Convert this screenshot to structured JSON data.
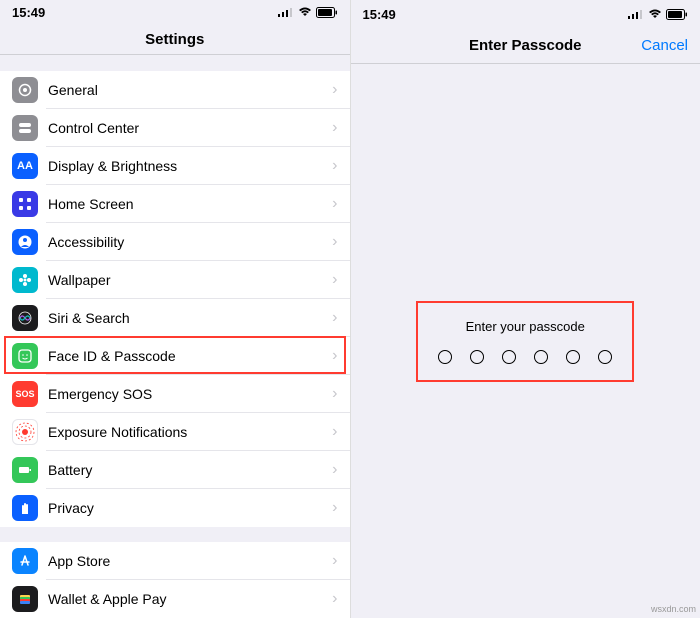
{
  "status": {
    "time": "15:49",
    "location_arrow": "↗"
  },
  "left": {
    "title": "Settings",
    "items": [
      {
        "label": "General",
        "icon": "gear",
        "color": "#8e8e93"
      },
      {
        "label": "Control Center",
        "icon": "switches",
        "color": "#8e8e93"
      },
      {
        "label": "Display & Brightness",
        "icon": "AA",
        "color": "#0a60ff"
      },
      {
        "label": "Home Screen",
        "icon": "grid",
        "color": "#3a3ae6"
      },
      {
        "label": "Accessibility",
        "icon": "person",
        "color": "#0a60ff"
      },
      {
        "label": "Wallpaper",
        "icon": "flower",
        "color": "#00b9ce"
      },
      {
        "label": "Siri & Search",
        "icon": "siri",
        "color": "#1c1c1e"
      },
      {
        "label": "Face ID & Passcode",
        "icon": "face",
        "color": "#34c759"
      },
      {
        "label": "Emergency SOS",
        "icon": "SOS",
        "color": "#ff3b30"
      },
      {
        "label": "Exposure Notifications",
        "icon": "exposure",
        "color": "#ffffff"
      },
      {
        "label": "Battery",
        "icon": "battery",
        "color": "#34c759"
      },
      {
        "label": "Privacy",
        "icon": "hand",
        "color": "#0a60ff"
      }
    ],
    "group2": [
      {
        "label": "App Store",
        "icon": "appstore",
        "color": "#0a84ff"
      },
      {
        "label": "Wallet & Apple Pay",
        "icon": "wallet",
        "color": "#1c1c1e"
      }
    ],
    "highlight_index": 7
  },
  "right": {
    "title": "Enter Passcode",
    "cancel": "Cancel",
    "prompt": "Enter your passcode",
    "digits": 6
  },
  "watermark": "wsxdn.com"
}
